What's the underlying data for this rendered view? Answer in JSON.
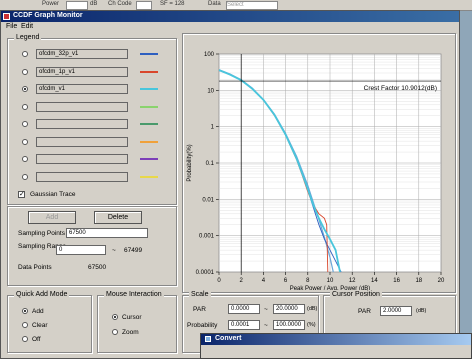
{
  "background_app": {
    "power_label": "Power",
    "db_label": "dB",
    "ch_code_label": "Ch Code",
    "sf_label": "SF = 128",
    "data_label": "Data",
    "data_value": "Select"
  },
  "window": {
    "title": "CCDF Graph Monitor",
    "menu": [
      "File",
      "Edit"
    ]
  },
  "legend": {
    "label": "Legend",
    "rows": [
      {
        "name": "ofcdm_32p_v1",
        "color": "#2e5fc0",
        "selected": false
      },
      {
        "name": "ofcdm_1p_v1",
        "color": "#d9462b",
        "selected": false
      },
      {
        "name": "ofcdm_v1",
        "color": "#49c6dc",
        "selected": true
      },
      {
        "name": "",
        "color": "#8ad36d",
        "selected": false
      },
      {
        "name": "",
        "color": "#4a9a6c",
        "selected": false
      },
      {
        "name": "",
        "color": "#f0a13a",
        "selected": false
      },
      {
        "name": "",
        "color": "#7d3fb8",
        "selected": false
      },
      {
        "name": "",
        "color": "#e8d84a",
        "selected": false
      }
    ],
    "gaussian_label": "Gaussian Trace",
    "gaussian_checked": true
  },
  "trace_controls": {
    "add_label": "Add",
    "delete_label": "Delete",
    "sampling_points_label": "Sampling Points",
    "sampling_points_value": "67500",
    "sampling_range_label": "Sampling Range",
    "range_from": "0",
    "range_dash": "~",
    "range_to": "67499",
    "data_points_label": "Data Points",
    "data_points_value": "67500"
  },
  "quick_add": {
    "label": "Quick Add Mode",
    "options": [
      "Add",
      "Clear",
      "Off"
    ],
    "selected": "Add"
  },
  "mouse_interaction": {
    "label": "Mouse Interaction",
    "options": [
      "Cursor",
      "Zoom"
    ],
    "selected": "Cursor"
  },
  "scale": {
    "label": "Scale",
    "par_label": "PAR",
    "par_from": "0.0000",
    "par_to": "20.0000",
    "par_unit": "(dB)",
    "prob_label": "Probability",
    "prob_from": "0.0001",
    "prob_to": "100.0000",
    "prob_unit": "(%)",
    "dash": "~"
  },
  "cursor_position": {
    "label": "Cursor Position",
    "par_label": "PAR",
    "par_value": "2.0000",
    "par_unit": "(dB)"
  },
  "convert_dialog": {
    "title": "Convert"
  },
  "chart_data": {
    "type": "line",
    "xlabel": "Peak Power / Avg. Power (dB)",
    "ylabel": "Probability(%)",
    "xlim": [
      0,
      20
    ],
    "ylim": [
      0.0001,
      100
    ],
    "y_scale": "log",
    "x_ticks": [
      0,
      2,
      4,
      6,
      8,
      10,
      12,
      14,
      16,
      18,
      20
    ],
    "y_ticks": [
      "0.0001",
      "0.001",
      "0.01",
      "0.1",
      "1",
      "10",
      "100"
    ],
    "grid": true,
    "annotation": "Crest Factor 10.9012(dB)",
    "cursor": {
      "x": 2.0,
      "y": 18
    },
    "series": [
      {
        "color": "#2e5fc0",
        "points": [
          [
            0,
            35
          ],
          [
            1,
            27
          ],
          [
            2,
            19
          ],
          [
            3,
            11
          ],
          [
            4,
            5.5
          ],
          [
            5,
            2.1
          ],
          [
            6,
            0.62
          ],
          [
            7,
            0.13
          ],
          [
            7.5,
            0.05
          ],
          [
            8,
            0.018
          ],
          [
            8.5,
            0.006
          ],
          [
            9,
            0.002
          ],
          [
            9.5,
            0.0008
          ],
          [
            10,
            0.0004
          ],
          [
            10.5,
            0.0002
          ],
          [
            11,
            0.0001
          ]
        ]
      },
      {
        "color": "#d9462b",
        "points": [
          [
            0,
            36
          ],
          [
            1,
            27
          ],
          [
            2,
            19
          ],
          [
            3,
            11
          ],
          [
            4,
            5.4
          ],
          [
            5,
            2.0
          ],
          [
            6,
            0.58
          ],
          [
            7,
            0.12
          ],
          [
            7.5,
            0.045
          ],
          [
            8,
            0.016
          ],
          [
            8.5,
            0.007
          ],
          [
            9,
            0.004
          ],
          [
            9.5,
            0.003
          ],
          [
            9.7,
            0.002
          ],
          [
            9.8,
            0.0001
          ]
        ]
      },
      {
        "color": "#49c6dc",
        "points": [
          [
            0,
            36
          ],
          [
            1,
            27
          ],
          [
            2,
            19
          ],
          [
            3,
            11
          ],
          [
            4,
            5.5
          ],
          [
            5,
            2.1
          ],
          [
            6,
            0.6
          ],
          [
            7,
            0.13
          ],
          [
            7.5,
            0.05
          ],
          [
            8,
            0.019
          ],
          [
            8.5,
            0.007
          ],
          [
            9,
            0.003
          ],
          [
            9.5,
            0.0015
          ],
          [
            10,
            0.0008
          ],
          [
            10.5,
            0.0004
          ],
          [
            10.9,
            0.0001
          ]
        ]
      }
    ],
    "gaussian": {
      "color": "#6aa6d8",
      "points": [
        [
          0,
          37
        ],
        [
          1,
          28
        ],
        [
          2,
          19.5
        ],
        [
          3,
          11.5
        ],
        [
          4,
          5.6
        ],
        [
          5,
          2.2
        ],
        [
          6,
          0.65
        ],
        [
          7,
          0.15
        ],
        [
          8,
          0.024
        ],
        [
          9,
          0.0028
        ],
        [
          9.5,
          0.0009
        ],
        [
          10,
          0.00025
        ],
        [
          10.3,
          0.0001
        ]
      ]
    }
  }
}
